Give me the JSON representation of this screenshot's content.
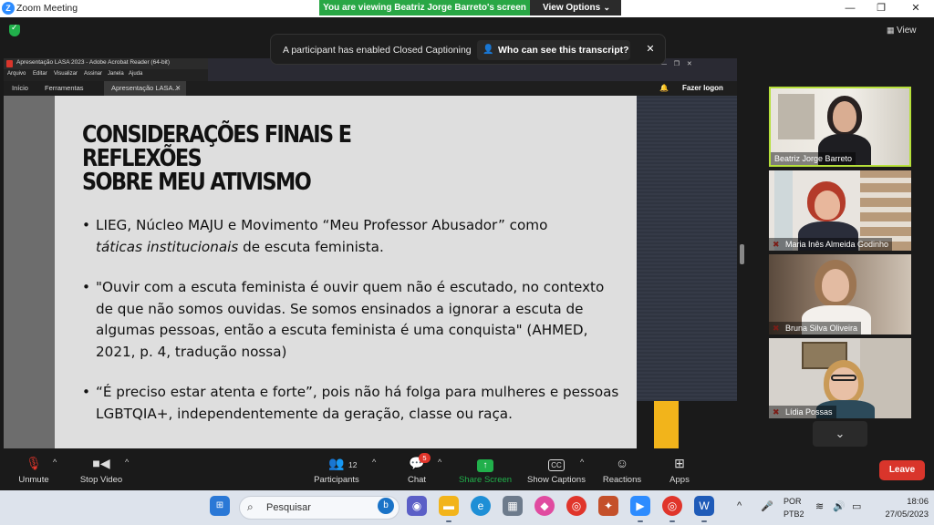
{
  "window": {
    "title": "Zoom Meeting"
  },
  "share_banner": {
    "text": "You are viewing Beatriz Jorge Barreto's screen",
    "options_label": "View Options"
  },
  "top_bar": {
    "view_label": "View"
  },
  "caption_toast": {
    "message": "A participant has enabled Closed Captioning",
    "who_button": "Who can see this transcript?"
  },
  "acrobat": {
    "title": "Apresentação LASA 2023 - Adobe Acrobat Reader (64-bit)",
    "menu": [
      "Arquivo",
      "Editar",
      "Visualizar",
      "Assinar",
      "Janela",
      "Ajuda"
    ],
    "tabs": [
      "Início",
      "Ferramentas",
      "Apresentação LASA..."
    ],
    "login": "Fazer logon"
  },
  "slide": {
    "title_line1": "Considerações finais e reflexões",
    "title_line2": "sobre meu ativismo",
    "bullet_char": "•",
    "b1_part1": "LIEG, Núcleo MAJU e  Movimento “Meu Professor Abusador” como",
    "b1_italic": "táticas institucionais",
    "b1_part2": " de escuta feminista.",
    "b2": "\"Ouvir com a escuta feminista é ouvir quem não é escutado, no contexto de que não somos ouvidas. Se somos ensinados a ignorar a escuta de algumas pessoas, então a escuta feminista é uma conquista\" (AHMED, 2021, p. 4, tradução nossa)",
    "b3": "“É preciso estar atenta e forte”, pois não há folga para mulheres e pessoas LGBTQIA+, independentemente da geração, classe ou raça."
  },
  "participants": [
    {
      "name": "Beatriz Jorge Barreto",
      "muted": false,
      "active": true
    },
    {
      "name": "Maria Inês Almeida Godinho",
      "muted": true,
      "active": false
    },
    {
      "name": "Bruna Silva Oliveira",
      "muted": true,
      "active": false
    },
    {
      "name": "Lídia Possas",
      "muted": true,
      "active": false
    }
  ],
  "toolbar": {
    "unmute": "Unmute",
    "stop_video": "Stop Video",
    "participants": "Participants",
    "participants_count": "12",
    "chat": "Chat",
    "chat_badge": "5",
    "share_screen": "Share Screen",
    "show_captions": "Show Captions",
    "cc_icon": "CC",
    "reactions": "Reactions",
    "apps": "Apps",
    "leave": "Leave"
  },
  "taskbar": {
    "search_placeholder": "Pesquisar",
    "lang_line1": "POR",
    "lang_line2": "PTB2",
    "time": "18:06",
    "date": "27/05/2023"
  },
  "colors": {
    "share_green": "#29a745",
    "leave_red": "#d9352b",
    "active_border": "#b6e03a",
    "slide_bg": "#dedede",
    "slide_accent": "#f2b41b"
  }
}
